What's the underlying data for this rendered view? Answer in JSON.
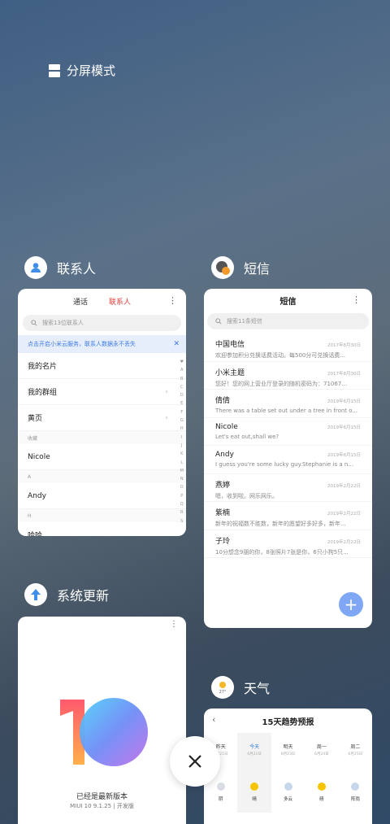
{
  "split_screen": {
    "label": "分屏模式"
  },
  "contacts": {
    "title": "联系人",
    "tabs": [
      "通话",
      "联系人"
    ],
    "search_placeholder": "搜索13位联系人",
    "banner": "点击开启小米云服务，联系人数据永不丢失",
    "rows": [
      {
        "type": "item",
        "label": "我的名片",
        "chevron": false
      },
      {
        "type": "item",
        "label": "我的群组",
        "chevron": true
      },
      {
        "type": "item",
        "label": "黄页",
        "chevron": true
      },
      {
        "type": "section",
        "label": "收藏"
      },
      {
        "type": "item",
        "label": "Nicole",
        "chevron": false
      },
      {
        "type": "section",
        "label": "A"
      },
      {
        "type": "item",
        "label": "Andy",
        "chevron": false
      },
      {
        "type": "section",
        "label": "H"
      },
      {
        "type": "item",
        "label": "哈哈",
        "chevron": false
      }
    ],
    "alphabet": [
      "♥",
      "A",
      "B",
      "C",
      "D",
      "E",
      "F",
      "G",
      "H",
      "I",
      "J",
      "K",
      "L",
      "M",
      "N",
      "O",
      "P",
      "Q",
      "R",
      "S"
    ]
  },
  "sms": {
    "title": "短信",
    "header": "短信",
    "search_placeholder": "搜索11条短信",
    "messages": [
      {
        "name": "中国电信",
        "date": "2017年8月30日",
        "text": "欢迎参加积分兑换话费活动。每500分可兑换话费..."
      },
      {
        "name": "小米主题",
        "date": "2017年8月30日",
        "text": "您好！您的网上营业厅登录的随机密码为：71067..."
      },
      {
        "name": "倩倩",
        "date": "2019年6月15日",
        "text": "There was a table set out under a tree in front o..."
      },
      {
        "name": "Nicole",
        "date": "2019年6月15日",
        "text": "Let's eat out,shall we?"
      },
      {
        "name": "Andy",
        "date": "2019年6月15日",
        "text": "I guess you're some lucky guy.Stephanie is a n..."
      },
      {
        "name": "燕婷",
        "date": "2019年2月22日",
        "text": "嗯，收到啦。网乐网乐。"
      },
      {
        "name": "紫楠",
        "date": "2019年2月22日",
        "text": "新年的祝福数不胜数，新年的愿望好多好多，新年..."
      },
      {
        "name": "子玲",
        "date": "2019年2月22日",
        "text": "10分想念9朋的你，8张照片7张是你，6只小狗5只..."
      }
    ],
    "fab": "+"
  },
  "update": {
    "title": "系统更新",
    "status": "已经是最新版本",
    "version": "MIUI 10 9.1.25 | 开发版"
  },
  "weather": {
    "title": "天气",
    "icon_temp": "27°",
    "header": "15天趋势预报",
    "days": [
      {
        "day": "昨天",
        "date": "6月21日",
        "cond": "阴",
        "icon_color": "#d9dde3",
        "today": false
      },
      {
        "day": "今天",
        "date": "6月22日",
        "cond": "晴",
        "icon_color": "#f6c400",
        "today": true
      },
      {
        "day": "明天",
        "date": "6月23日",
        "cond": "多云",
        "icon_color": "#c8d7ea",
        "today": false
      },
      {
        "day": "周一",
        "date": "6月24日",
        "cond": "晴",
        "icon_color": "#f6c400",
        "today": false
      },
      {
        "day": "周二",
        "date": "6月25日",
        "cond": "阵雨",
        "icon_color": "#c8d7ea",
        "today": false
      }
    ]
  }
}
